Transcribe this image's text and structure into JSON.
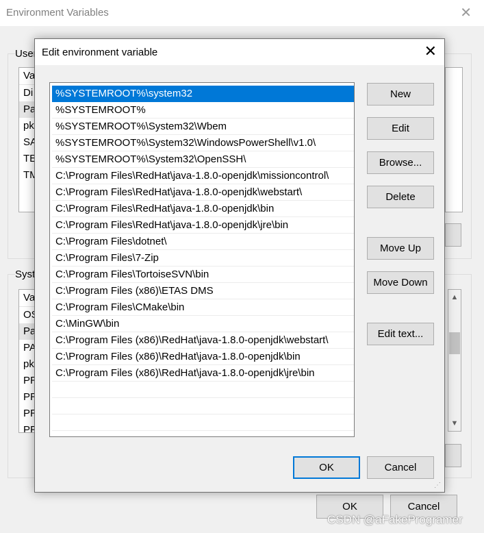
{
  "parent": {
    "title": "Environment Variables",
    "close_glyph": "✕",
    "user_group_label": "User",
    "user_vars_partial": [
      "Va",
      "Di",
      "Pa",
      "pk",
      "SA",
      "TE",
      "TM"
    ],
    "system_group_label": "Syste",
    "system_vars_partial": [
      "Va",
      "OS",
      "Pa",
      "PA",
      "pk",
      "PR",
      "PR",
      "PR",
      "PR"
    ],
    "ok_label": "OK",
    "cancel_label": "Cancel"
  },
  "dialog": {
    "title": "Edit environment variable",
    "close_glyph": "✕",
    "paths": [
      "%SYSTEMROOT%\\system32",
      "%SYSTEMROOT%",
      "%SYSTEMROOT%\\System32\\Wbem",
      "%SYSTEMROOT%\\System32\\WindowsPowerShell\\v1.0\\",
      "%SYSTEMROOT%\\System32\\OpenSSH\\",
      "C:\\Program Files\\RedHat\\java-1.8.0-openjdk\\missioncontrol\\",
      "C:\\Program Files\\RedHat\\java-1.8.0-openjdk\\webstart\\",
      "C:\\Program Files\\RedHat\\java-1.8.0-openjdk\\bin",
      "C:\\Program Files\\RedHat\\java-1.8.0-openjdk\\jre\\bin",
      "C:\\Program Files\\dotnet\\",
      "C:\\Program Files\\7-Zip",
      "C:\\Program Files\\TortoiseSVN\\bin",
      "C:\\Program Files (x86)\\ETAS DMS",
      "C:\\Program Files\\CMake\\bin",
      "C:\\MinGW\\bin",
      "C:\\Program Files (x86)\\RedHat\\java-1.8.0-openjdk\\webstart\\",
      "C:\\Program Files (x86)\\RedHat\\java-1.8.0-openjdk\\bin",
      "C:\\Program Files (x86)\\RedHat\\java-1.8.0-openjdk\\jre\\bin"
    ],
    "selected_index": 0,
    "buttons": {
      "new": "New",
      "edit": "Edit",
      "browse": "Browse...",
      "delete": "Delete",
      "move_up": "Move Up",
      "move_down": "Move Down",
      "edit_text": "Edit text..."
    },
    "ok_label": "OK",
    "cancel_label": "Cancel"
  },
  "watermark": "CSDN @aFakeProgramer",
  "colors": {
    "selection": "#0078d7",
    "default_button_border": "#0078d7"
  }
}
